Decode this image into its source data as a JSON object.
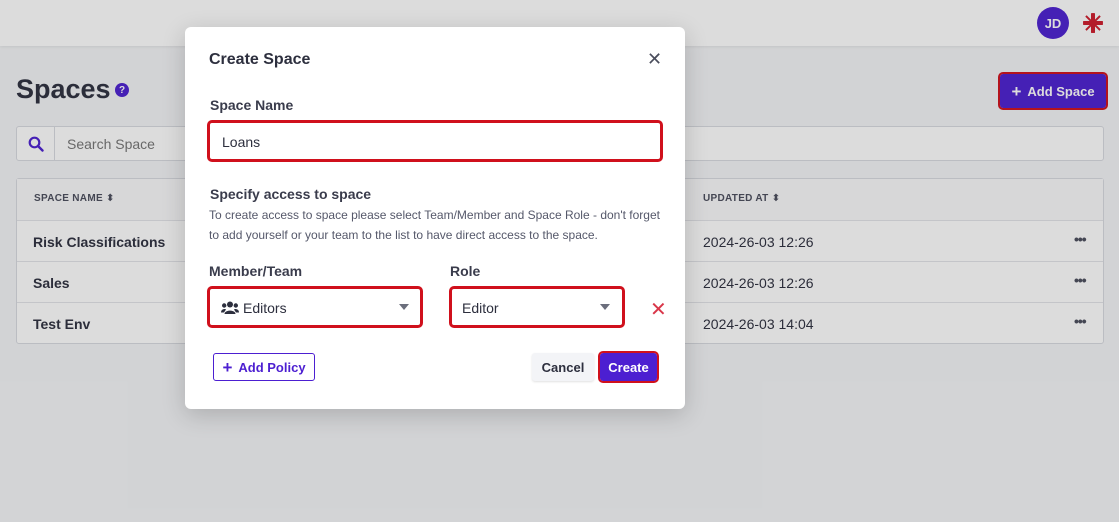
{
  "header": {
    "avatar_initials": "JD",
    "flag_icon": "uk-flag-icon"
  },
  "page": {
    "title": "Spaces",
    "help_icon": "question-icon",
    "add_space_label": "Add Space",
    "search_placeholder": "Search Space"
  },
  "table": {
    "columns": [
      "SPACE NAME",
      "UPDATED AT"
    ],
    "rows": [
      {
        "name": "Risk Classifications",
        "updated": "2024-26-03 12:26"
      },
      {
        "name": "Sales",
        "updated": "2024-26-03 12:26"
      },
      {
        "name": "Test Env",
        "updated": "2024-26-03 14:04"
      }
    ],
    "row_menu_glyph": "•••"
  },
  "modal": {
    "title": "Create Space",
    "space_name_label": "Space Name",
    "space_name_value": "Loans",
    "access_heading": "Specify access to space",
    "access_hint_line1": "To create access to space please select Team/Member and Space Role - don't forget",
    "access_hint_line2": "to add yourself or your team to the list to have direct access to the space.",
    "member_label": "Member/Team",
    "member_value": "Editors",
    "role_label": "Role",
    "role_value": "Editor",
    "add_policy_label": "Add Policy",
    "cancel_label": "Cancel",
    "create_label": "Create"
  },
  "colors": {
    "accent": "#4c1fd1",
    "highlight": "#d0101c",
    "remove": "#d93649"
  }
}
